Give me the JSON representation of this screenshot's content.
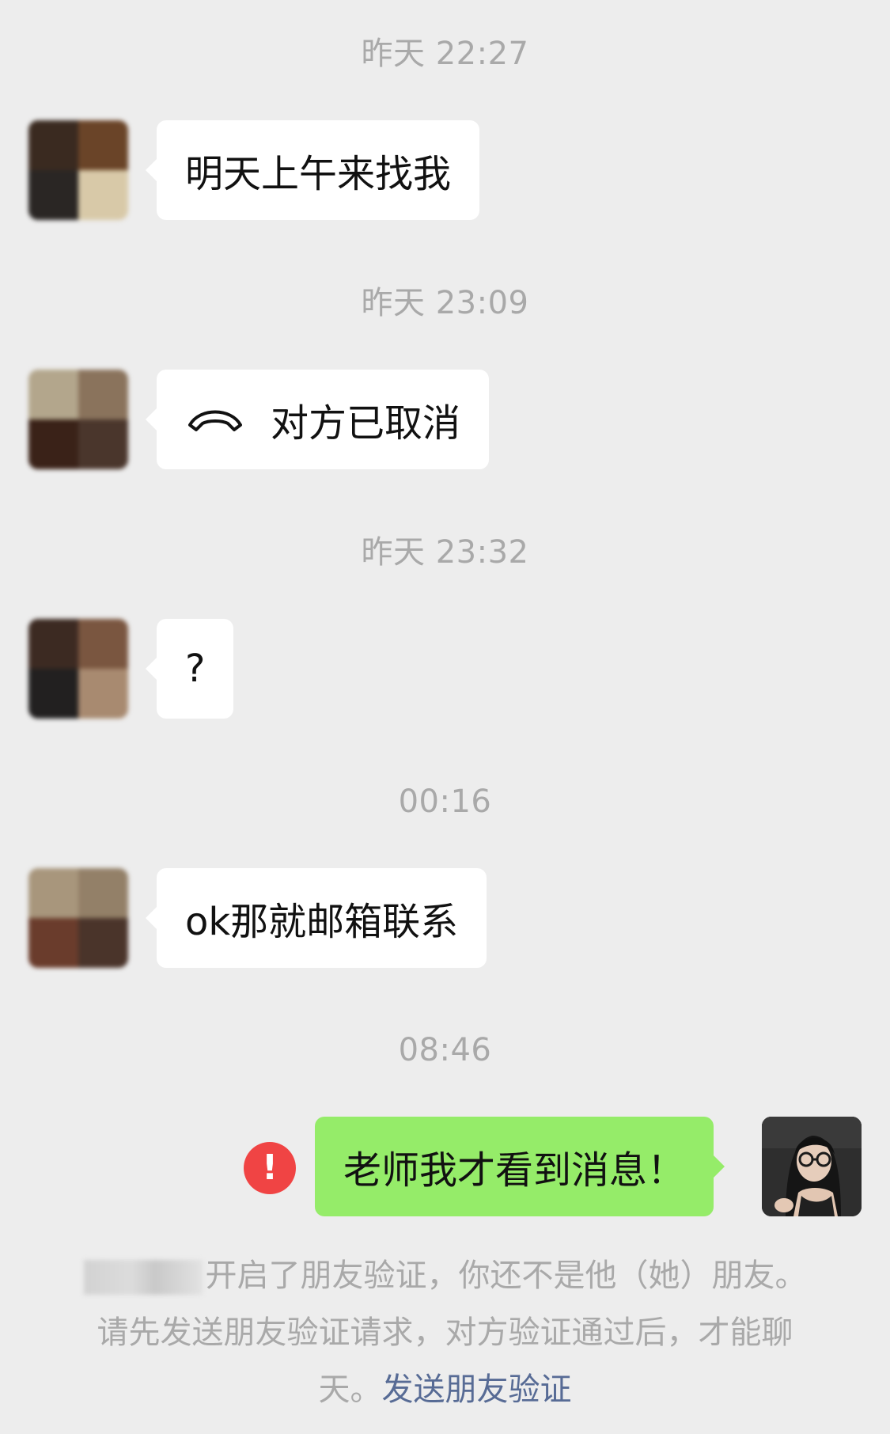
{
  "messages": [
    {
      "timestamp": "昨天 22:27",
      "text": "明天上午来找我"
    },
    {
      "timestamp": "昨天 23:09",
      "text": "对方已取消",
      "icon": "hang-up-phone-icon"
    },
    {
      "timestamp": "昨天 23:32",
      "text": "?"
    },
    {
      "timestamp": "00:16",
      "text": "ok那就邮箱联系"
    },
    {
      "timestamp": "08:46",
      "text": "老师我才看到消息！",
      "status": "send-failed",
      "status_icon_text": "!"
    }
  ],
  "system_notice": {
    "text": "开启了朋友验证，你还不是他（她）朋友。请先发送朋友验证请求，对方验证通过后，才能聊天。",
    "link": "发送朋友验证"
  },
  "colors": {
    "background": "#ededed",
    "incoming_bubble": "#ffffff",
    "outgoing_bubble": "#95ec69",
    "error": "#f04444",
    "link": "#576b95",
    "timestamp_text": "#a9a9a9"
  }
}
